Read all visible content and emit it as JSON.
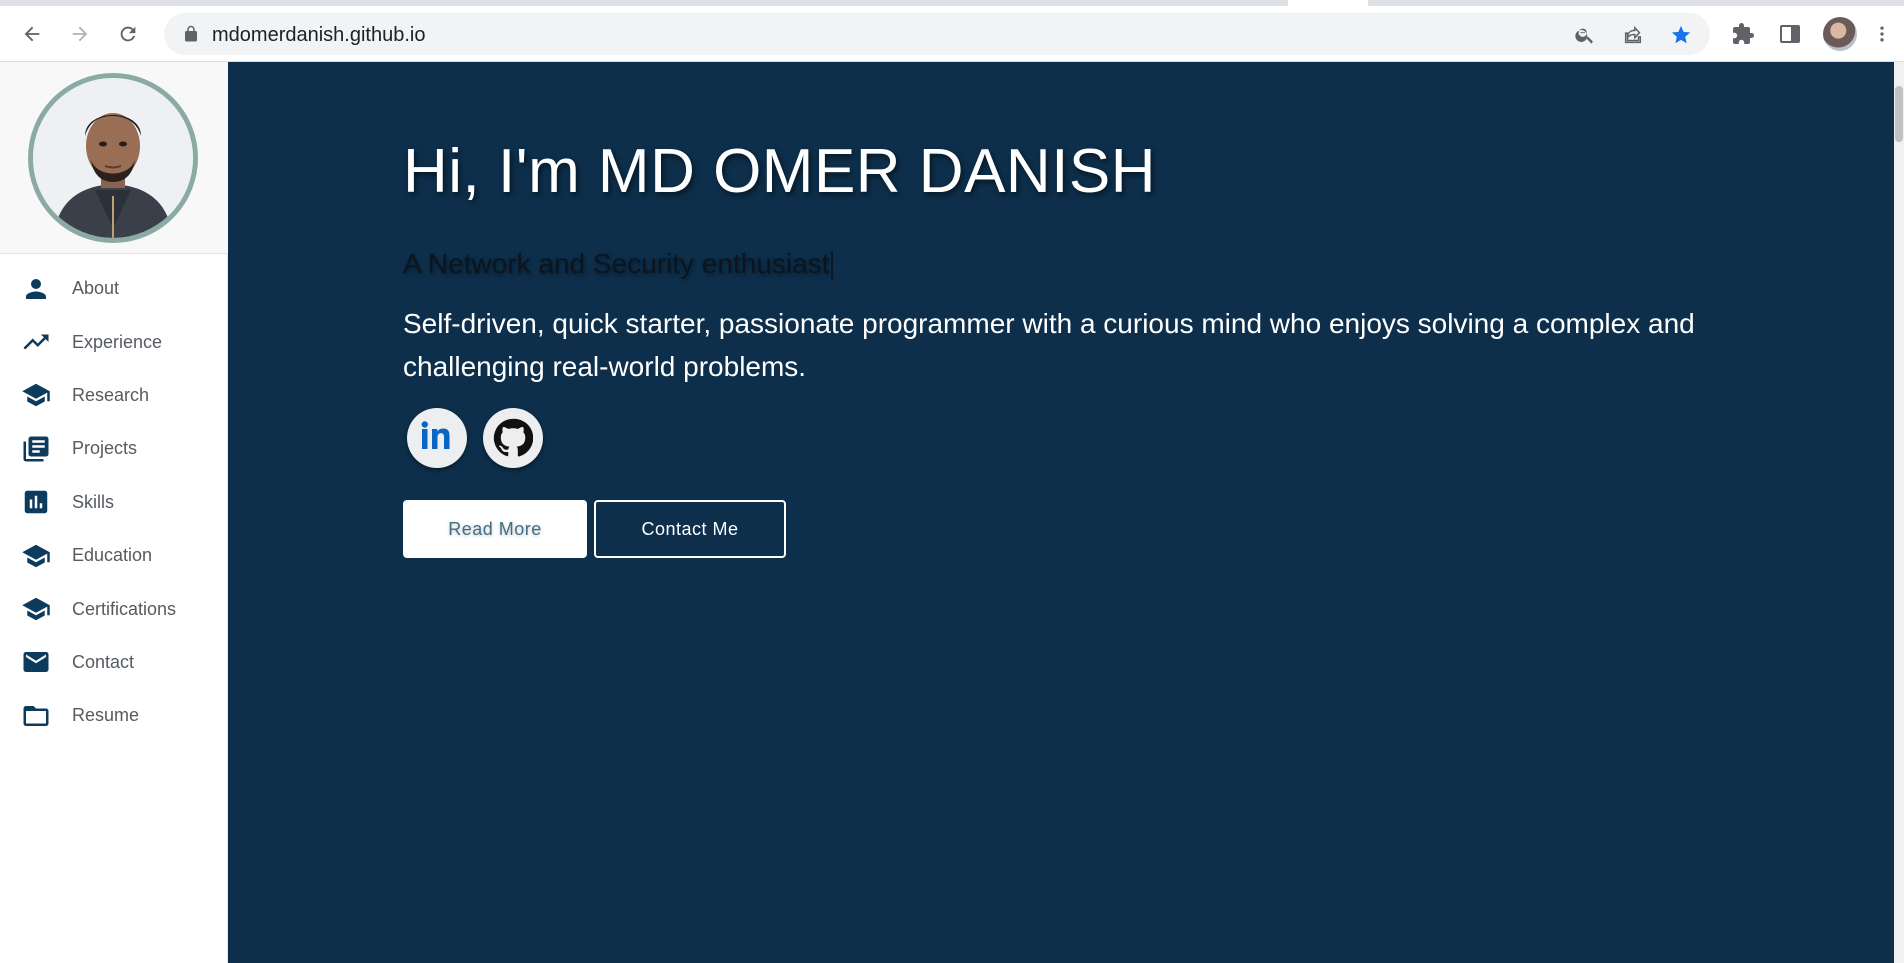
{
  "browser": {
    "url": "mdomerdanish.github.io",
    "icons": [
      "back-icon",
      "forward-icon",
      "reload-icon",
      "lock-icon",
      "zoom-icon",
      "share-icon",
      "bookmark-star-icon",
      "extensions-icon",
      "side-panel-icon",
      "menu-icon"
    ],
    "accent_color": "#1a73e8"
  },
  "sidebar": {
    "items": [
      {
        "label": "About",
        "icon": "person-icon"
      },
      {
        "label": "Experience",
        "icon": "trending-up-icon"
      },
      {
        "label": "Research",
        "icon": "school-icon"
      },
      {
        "label": "Projects",
        "icon": "library-books-icon"
      },
      {
        "label": "Skills",
        "icon": "bar-chart-icon"
      },
      {
        "label": "Education",
        "icon": "school-icon"
      },
      {
        "label": "Certifications",
        "icon": "school-icon"
      },
      {
        "label": "Contact",
        "icon": "mail-icon"
      },
      {
        "label": "Resume",
        "icon": "folder-icon"
      }
    ],
    "icon_color": "#0d3b5e"
  },
  "hero": {
    "title": "Hi, I'm MD OMER DANISH",
    "tagline": "A Network and Security enthusiast",
    "bio": "Self-driven, quick starter, passionate programmer with a curious mind who enjoys solving a complex and challenging real-world problems.",
    "social": [
      {
        "name": "linkedin-icon",
        "color": "#0a66c2"
      },
      {
        "name": "github-icon",
        "color": "#111111"
      }
    ],
    "buttons": {
      "read_more": "Read More",
      "contact_me": "Contact Me"
    },
    "background_color": "#0d2f4b"
  }
}
